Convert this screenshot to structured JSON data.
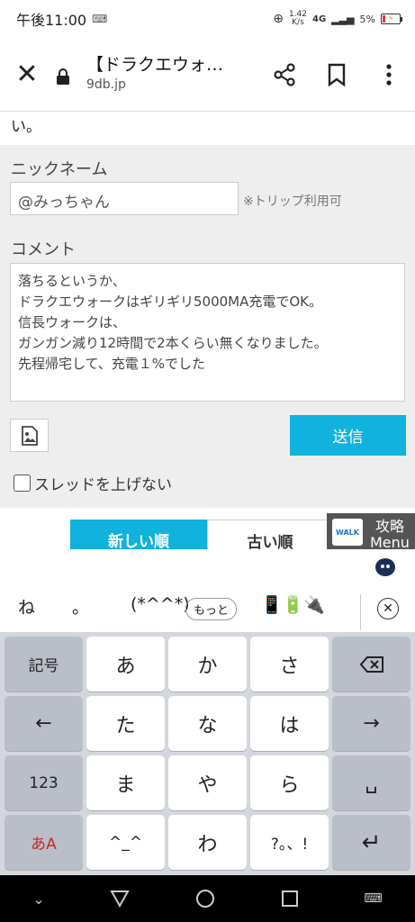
{
  "status": {
    "time": "午後11:00",
    "net_rate_top": "1.42",
    "net_rate_bottom": "K/s",
    "signal": "4G",
    "battery": "5%"
  },
  "toolbar": {
    "title": "【ドラクエウォ…",
    "url": "9db.jp"
  },
  "page": {
    "top_text": "い。",
    "nickname_label": "ニックネーム",
    "nickname_value": "@みっちゃん",
    "trip_note": "※トリップ利用可",
    "comment_label": "コメント",
    "comment_lines": [
      "落ちるというか、",
      "ドラクエウォークはギリギリ5000MA充電でOK。",
      "信長ウォークは、",
      "ガンガン減り12時間で2本くらい無くなりました。",
      "先程帰宅して、充電１%でした"
    ],
    "send_label": "送信",
    "no_age_label": "スレッドを上げない",
    "sort_new": "新しい順",
    "sort_old": "古い順",
    "menu_line1": "攻略",
    "menu_line2": "Menu",
    "menu_logo": "WALK"
  },
  "keyboard": {
    "candidates": [
      "ね",
      "。",
      "(*^^*)",
      "📱🔋🔌"
    ],
    "more": "もっと",
    "keys": [
      [
        "記号",
        "あ",
        "か",
        "さ",
        "⌫"
      ],
      [
        "←",
        "た",
        "な",
        "は",
        "→"
      ],
      [
        "123",
        "ま",
        "や",
        "ら",
        "␣"
      ],
      [
        "あA",
        "^_^",
        "わ",
        "?。、!",
        "↵"
      ]
    ]
  }
}
